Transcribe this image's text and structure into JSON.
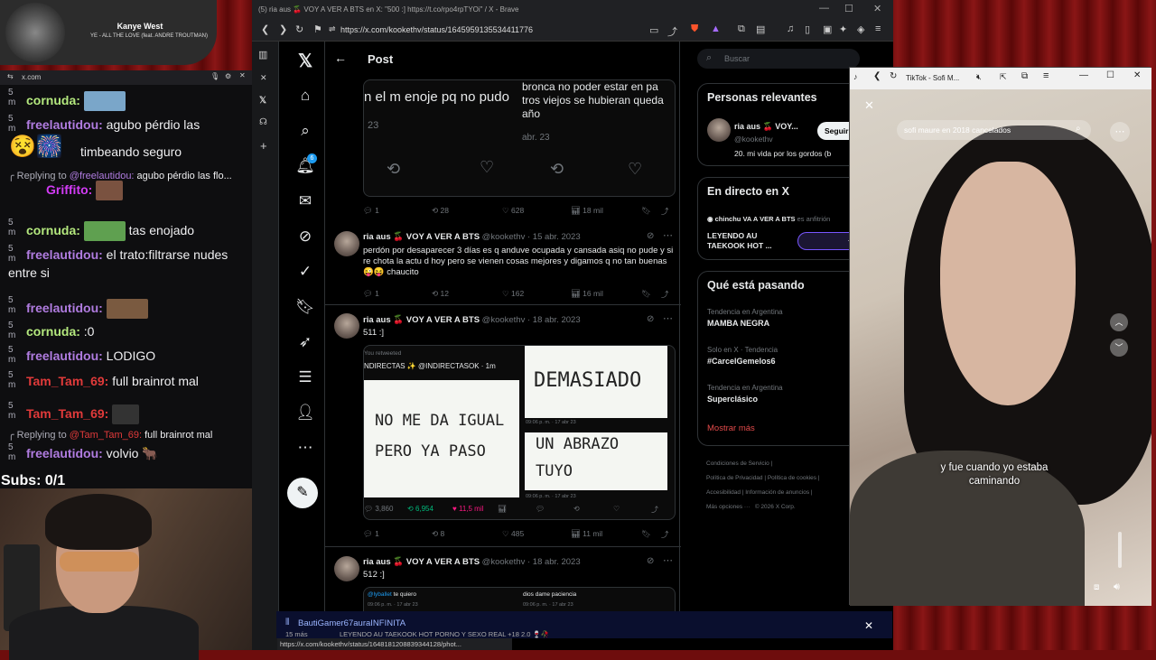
{
  "colors": {
    "accent": "#1d9bf0",
    "like": "#f91880",
    "retweet": "#00ba7c",
    "curtain": "#8a1616"
  },
  "music": {
    "artist": "Kanye West",
    "song": "YE - ALL THE LOVE (feat. ANDRE TROUTMAN)"
  },
  "chat": {
    "domain": "x.com",
    "messages": [
      {
        "ts": "5\nm",
        "user": "cornuda:",
        "text": "",
        "color": "#b4e87e"
      },
      {
        "ts": "5\nm",
        "user": "freelautidou:",
        "text": "agubo pérdio las",
        "color": "#b07ce0"
      },
      {
        "ts": "",
        "user": "",
        "text": "timbeando seguro",
        "color": "#fff"
      },
      {
        "ts": "",
        "user": "Griffito:",
        "text": "",
        "color": "#d23bf5"
      },
      {
        "ts": "5\nm",
        "user": "cornuda:",
        "text": "tas enojado",
        "color": "#b4e87e"
      },
      {
        "ts": "5\nm",
        "user": "freelautidou:",
        "text": "el trato:filtrarse nudes",
        "color": "#b07ce0"
      },
      {
        "ts": "",
        "user": "",
        "text": "entre si",
        "color": "#fff"
      },
      {
        "ts": "5\nm",
        "user": "freelautidou:",
        "text": "",
        "color": "#b07ce0"
      },
      {
        "ts": "5\nm",
        "user": "cornuda:",
        "text": ":0",
        "color": "#b4e87e"
      },
      {
        "ts": "5\nm",
        "user": "freelautidou:",
        "text": "LODIGO",
        "color": "#b07ce0"
      },
      {
        "ts": "5\nm",
        "user": "Tam_Tam_69:",
        "text": "full brainrot mal",
        "color": "#e03a3a"
      },
      {
        "ts": "5\nm",
        "user": "Tam_Tam_69:",
        "text": "",
        "color": "#e03a3a"
      },
      {
        "ts": "5\nm",
        "user": "freelautidou:",
        "text": "volvio",
        "color": "#b07ce0"
      }
    ],
    "reply1_prefix": "Replying to",
    "reply1_user": "@freelautidou:",
    "reply1_text": "agubo pérdio las flo...",
    "reply2_prefix": "Replying to",
    "reply2_user": "@Tam_Tam_69:",
    "reply2_text": "full brainrot mal",
    "subs": "Subs: 0/1"
  },
  "browser": {
    "title": "(5) ria aus 🍒 VOY A VER A BTS en X: \"500 :] https://t.co/rpo4rpTYOi\" / X - Brave",
    "url": "https://x.com/kookethv/status/1645959135534411776",
    "status_url": "https://x.com/kookethv/status/1648181208839344128/phot..."
  },
  "x": {
    "header": "Post",
    "notif_badge": "6",
    "search_placeholder": "Buscar",
    "quote_top": {
      "left_text": "n el m enoje pq no pudo",
      "left_date": "23",
      "right_text": "bronca no poder estar en pa\ntros viejos se hubieran queda\naño",
      "right_date": "abr. 23",
      "stats": [
        "1",
        "28",
        "628",
        "18 mil"
      ]
    },
    "tweets": [
      {
        "name": "ria aus 🍒 VOY A VER A BTS",
        "handle": "@kookethv · 15 abr. 2023",
        "text": "perdón por desaparecer 3 días es q anduve ocupada y cansada asiq no pude y si re chota la actu d hoy pero se vienen cosas mejores y digamos q no tan buenas 😜😝 chaucito",
        "stats": [
          "1",
          "12",
          "162",
          "16 mil"
        ]
      },
      {
        "name": "ria aus 🍒 VOY A VER A BTS",
        "handle": "@kookethv · 18 abr. 2023",
        "text": "511 :]",
        "stats": [
          "1",
          "8",
          "485",
          "11 mil"
        ],
        "retweeted_label": "You retweeted",
        "quote_author": "NDIRECTAS ✨ @INDIRECTASOK · 1m",
        "paper1": "NO ME DA IGUAL\nPERO YA PASO",
        "paper2": "DEMASIADO",
        "paper3": "UN ABRAZO\nTUYO",
        "paper_time": "09:06 p. m. · 17 abr 23",
        "quote_stats": [
          "3,860",
          "6,954",
          "11,5 mil"
        ]
      },
      {
        "name": "ria aus 🍒 VOY A VER A BTS",
        "handle": "@kookethv · 18 abr. 2023",
        "text": "512 :]",
        "quote_left_user": "@lyballet",
        "quote_left": "te quiero",
        "quote_right": "dios dame paciencia",
        "quote_time": "09:06 p. m. · 17 abr 23"
      }
    ],
    "right": {
      "relevant_title": "Personas relevantes",
      "rel_name": "ria aus 🍒 VOY...",
      "rel_handle": "@kookethv",
      "rel_follow": "Seguir",
      "rel_bio": "20. mi vida por los gordos (b",
      "live_title": "En directo en X",
      "live_host": "chinchu VA A VER A BTS",
      "live_host_suffix": "es anfitrión",
      "live_text": "LEYENDO AU TAEKOOK HOT ...",
      "live_count": "+1",
      "trends_title": "Qué está pasando",
      "trends": [
        {
          "context": "Tendencia en Argentina",
          "name": "MAMBA NEGRA"
        },
        {
          "context": "Solo en X · Tendencia",
          "name": "#CarcelGemelos6"
        },
        {
          "context": "Tendencia en Argentina",
          "name": "Superclásico"
        }
      ],
      "show_more": "Mostrar más",
      "footer": [
        "Condiciones de Servicio",
        "Política de Privacidad",
        "Política de cookies",
        "Accesibilidad",
        "Información de anuncios",
        "Más opciones ···",
        "© 2026 X Corp."
      ]
    }
  },
  "overlay": {
    "user": "BautiGamer67auraINFINITA",
    "time": "15 más",
    "text": "LEYENDO AU TAEKOOK HOT PORNO Y SEXO REAL +18 2.0 🍷🥀"
  },
  "tiktok": {
    "title": "TikTok - Sofi M...",
    "search": "sofi maure en 2018 cancelados",
    "caption": "y fue cuando yo estaba\ncaminando"
  }
}
